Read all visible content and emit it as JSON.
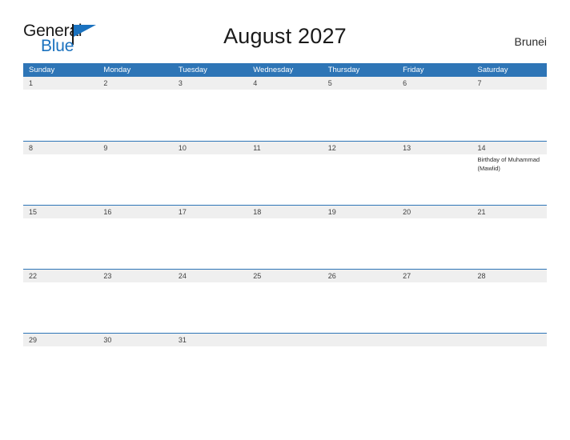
{
  "brand": {
    "word_one": "General",
    "word_two": "Blue",
    "triangle_color": "#1b72bf",
    "icon": "flag-triangle-icon"
  },
  "header": {
    "title": "August 2027",
    "region": "Brunei"
  },
  "colors": {
    "header_blue": "#2e75b6",
    "row_divider_blue": "#2e75b6",
    "date_band_gray": "#efefef",
    "page_background": "#ffffff",
    "date_text": "#3f3f3f"
  },
  "calendar": {
    "day_names": [
      "Sunday",
      "Monday",
      "Tuesday",
      "Wednesday",
      "Thursday",
      "Friday",
      "Saturday"
    ],
    "weeks": [
      [
        {
          "date": "1",
          "events": []
        },
        {
          "date": "2",
          "events": []
        },
        {
          "date": "3",
          "events": []
        },
        {
          "date": "4",
          "events": []
        },
        {
          "date": "5",
          "events": []
        },
        {
          "date": "6",
          "events": []
        },
        {
          "date": "7",
          "events": []
        }
      ],
      [
        {
          "date": "8",
          "events": []
        },
        {
          "date": "9",
          "events": []
        },
        {
          "date": "10",
          "events": []
        },
        {
          "date": "11",
          "events": []
        },
        {
          "date": "12",
          "events": []
        },
        {
          "date": "13",
          "events": []
        },
        {
          "date": "14",
          "events": [
            "Birthday of Muhammad (Mawlid)"
          ]
        }
      ],
      [
        {
          "date": "15",
          "events": []
        },
        {
          "date": "16",
          "events": []
        },
        {
          "date": "17",
          "events": []
        },
        {
          "date": "18",
          "events": []
        },
        {
          "date": "19",
          "events": []
        },
        {
          "date": "20",
          "events": []
        },
        {
          "date": "21",
          "events": []
        }
      ],
      [
        {
          "date": "22",
          "events": []
        },
        {
          "date": "23",
          "events": []
        },
        {
          "date": "24",
          "events": []
        },
        {
          "date": "25",
          "events": []
        },
        {
          "date": "26",
          "events": []
        },
        {
          "date": "27",
          "events": []
        },
        {
          "date": "28",
          "events": []
        }
      ],
      [
        {
          "date": "29",
          "events": []
        },
        {
          "date": "30",
          "events": []
        },
        {
          "date": "31",
          "events": []
        },
        {
          "date": "",
          "events": []
        },
        {
          "date": "",
          "events": []
        },
        {
          "date": "",
          "events": []
        },
        {
          "date": "",
          "events": []
        }
      ]
    ]
  }
}
